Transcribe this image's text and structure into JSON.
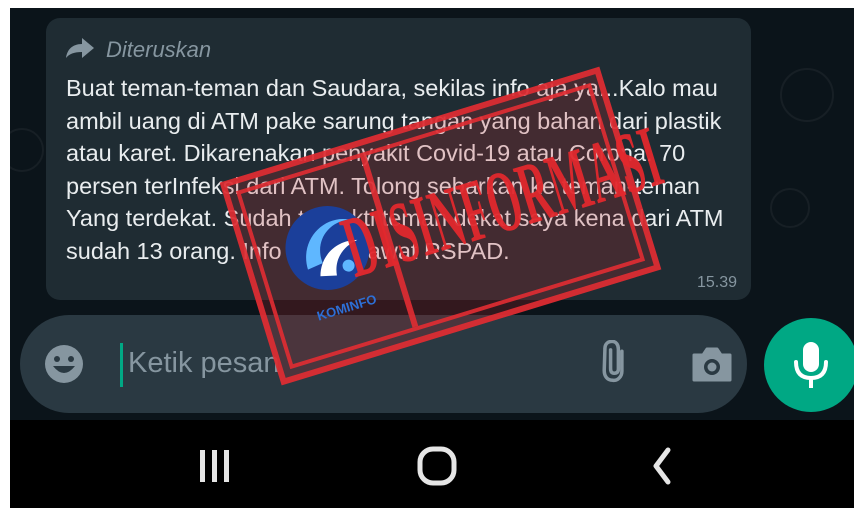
{
  "message": {
    "forwarded_label": "Diteruskan",
    "text": "Buat teman-teman dan Saudara, sekilas info aja ya...Kalo mau ambil uang di ATM pake sarung tangan yang bahan dari plastik atau karet. Dikarenakan penyakit Covid-19 atau Corona. 70 persen terInfeksi dari ATM. Tolong sebarkan ke teman-teman Yang terdekat. Sudah terbukti teman dekat saya kena dari ATM sudah 13 orang. Info dari perawat RSPAD.",
    "time": "15.39"
  },
  "input_bar": {
    "placeholder": "Ketik pesan"
  },
  "stamp": {
    "word": "DISINFORMASI",
    "logo_text": "KOMINFO"
  },
  "colors": {
    "background": "#0b141a",
    "bubble": "#1f2c33",
    "input_bar": "#2a3942",
    "accent_green": "#00a884",
    "stamp_red": "#de2d32"
  },
  "icons": [
    "forward-icon",
    "emoji-icon",
    "attach-icon",
    "camera-icon",
    "mic-icon",
    "recent-apps-icon",
    "home-icon",
    "back-icon"
  ]
}
